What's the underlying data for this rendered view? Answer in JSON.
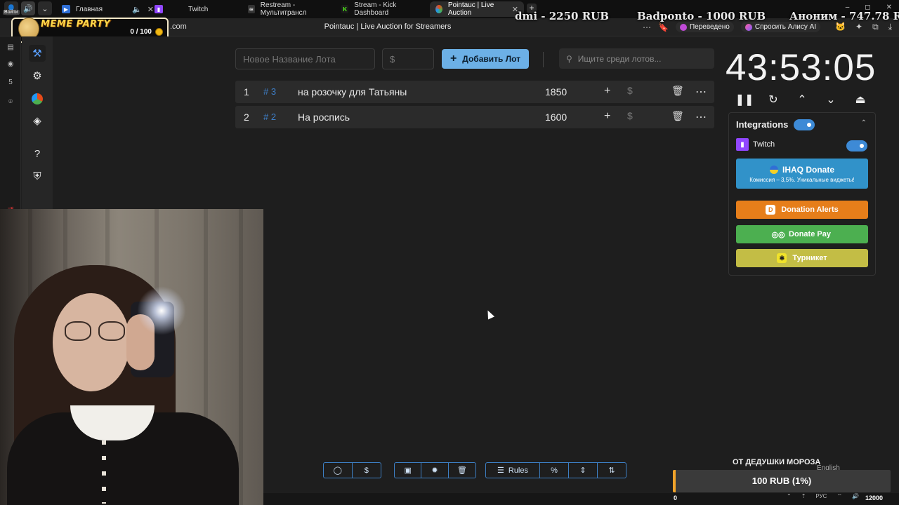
{
  "browser": {
    "tabs": [
      {
        "label": "Главная",
        "icon": "play-icon",
        "color": "#2f6fd6"
      },
      {
        "label": "Twitch",
        "icon": "twitch-icon",
        "color": "#9147ff"
      },
      {
        "label": "Restream - Мультитрансл",
        "icon": "restream-icon",
        "color": "#333333"
      },
      {
        "label": "Stream - Kick Dashboard",
        "icon": "kick-icon",
        "color": "#53fc18"
      },
      {
        "label": "Pointauc | Live Auction",
        "icon": "pointauc-icon",
        "color": "#e64a19"
      }
    ],
    "login_badge": "Войти",
    "url_fragment": ".com",
    "page_title": "Pointauc | Live Auction for Streamers",
    "translated_label": "Переведено",
    "ask_alice_label": "Спросить Алису AI"
  },
  "overlay": {
    "donations": [
      "dmi - 2250 RUB",
      "Badponto - 1000 RUB",
      "Аноним - 747.78 R"
    ],
    "meme_party": {
      "title": "MEME PARTY",
      "count": "0 / 100"
    }
  },
  "toolbar": {
    "lot_name_placeholder": "Новое Название Лота",
    "amount_placeholder": "$",
    "add_lot_label": "Добавить Лот",
    "search_placeholder": "Ищите среди лотов..."
  },
  "lots": [
    {
      "index": "1",
      "id": "# 3",
      "name": "на розочку для Татьяны",
      "amount": "1850"
    },
    {
      "index": "2",
      "id": "# 2",
      "name": "На роспись",
      "amount": "1600"
    }
  ],
  "timer": {
    "value": "43:53:05"
  },
  "integrations": {
    "title": "Integrations",
    "enabled": true,
    "twitch_label": "Twitch",
    "twitch_enabled": true,
    "ihaq_label": "IHAQ Donate",
    "ihaq_sub": "Комиссия – 3,5%. Уникальные виджеты!",
    "donation_alerts_label": "Donation Alerts",
    "donate_pay_label": "Donate Pay",
    "turniket_label": "Турникет",
    "colors": {
      "ihaq": "#3192c9",
      "donation_alerts": "#e67e1a",
      "donate_pay": "#4caf50",
      "turniket": "#c3bd45"
    }
  },
  "footer": {
    "rules_label": "Rules"
  },
  "goal": {
    "title": "ОТ ДЕДУШКИ МОРОЗА",
    "language": "English",
    "text": "100 RUB (1%)",
    "min": "0",
    "max": "12000",
    "progress": 0.01
  },
  "tray": {
    "lang": "РУС"
  },
  "colors": {
    "accent": "#6cb0e6",
    "lot_id": "#3e7fc8"
  }
}
